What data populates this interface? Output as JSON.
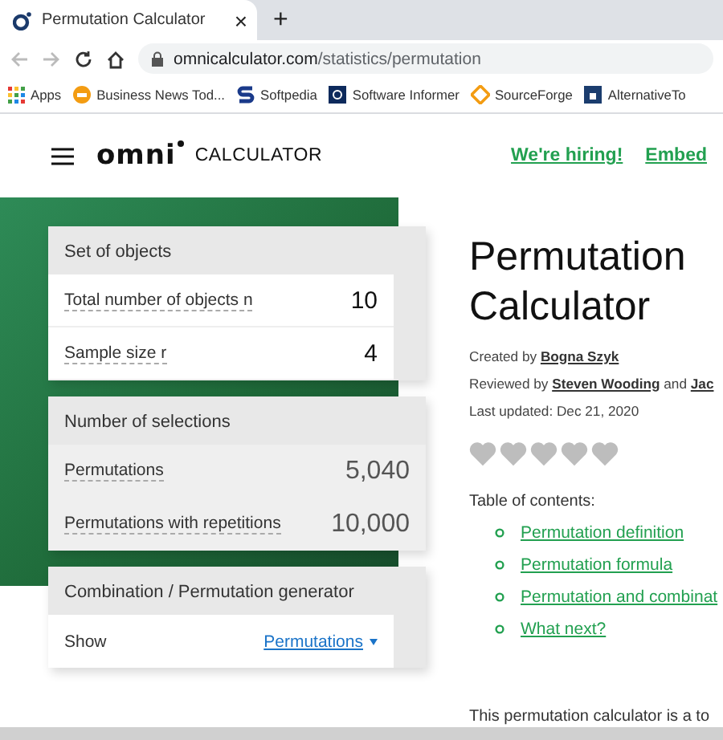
{
  "browser": {
    "tab": {
      "title": "Permutation Calculator",
      "close": "×"
    },
    "new_tab": "+",
    "url": {
      "domain": "omnicalculator.com",
      "path": "/statistics/permutation"
    },
    "bookmarks": [
      {
        "label": "Apps"
      },
      {
        "label": "Business News Tod..."
      },
      {
        "label": "Softpedia"
      },
      {
        "label": "Software Informer"
      },
      {
        "label": "SourceForge"
      },
      {
        "label": "AlternativeTo"
      }
    ]
  },
  "header": {
    "logo": "omni",
    "logo_suffix": "CALCULATOR",
    "links": [
      "We're hiring!",
      "Embed"
    ]
  },
  "sections": [
    {
      "title": "Set of objects",
      "rows": [
        {
          "kind": "input",
          "label": "Total number of objects n",
          "value": "10"
        },
        {
          "kind": "input",
          "label": "Sample size r",
          "value": "4"
        }
      ]
    },
    {
      "title": "Number of selections",
      "rows": [
        {
          "kind": "result",
          "label": "Permutations",
          "value": "5,040"
        },
        {
          "kind": "result",
          "label": "Permutations with repetitions",
          "value": "10,000"
        }
      ]
    },
    {
      "title": "Combination / Permutation generator",
      "rows": [
        {
          "kind": "select",
          "label": "Show",
          "value": "Permutations"
        }
      ]
    }
  ],
  "article": {
    "title": "Permutation Calculator",
    "created_prefix": "Created by",
    "author": "Bogna Szyk",
    "reviewed_prefix": "Reviewed by",
    "reviewer": "Steven Wooding",
    "reviewed_join": "and",
    "reviewer_2": "Jac",
    "updated": "Last updated: Dec 21, 2020",
    "rating": {
      "stars": 0
    },
    "toc_heading": "Table of contents:",
    "toc": [
      "Permutation definition",
      "Permutation formula",
      "Permutation and combinat",
      "What next?"
    ],
    "intro": "This permutation calculator is a to"
  }
}
